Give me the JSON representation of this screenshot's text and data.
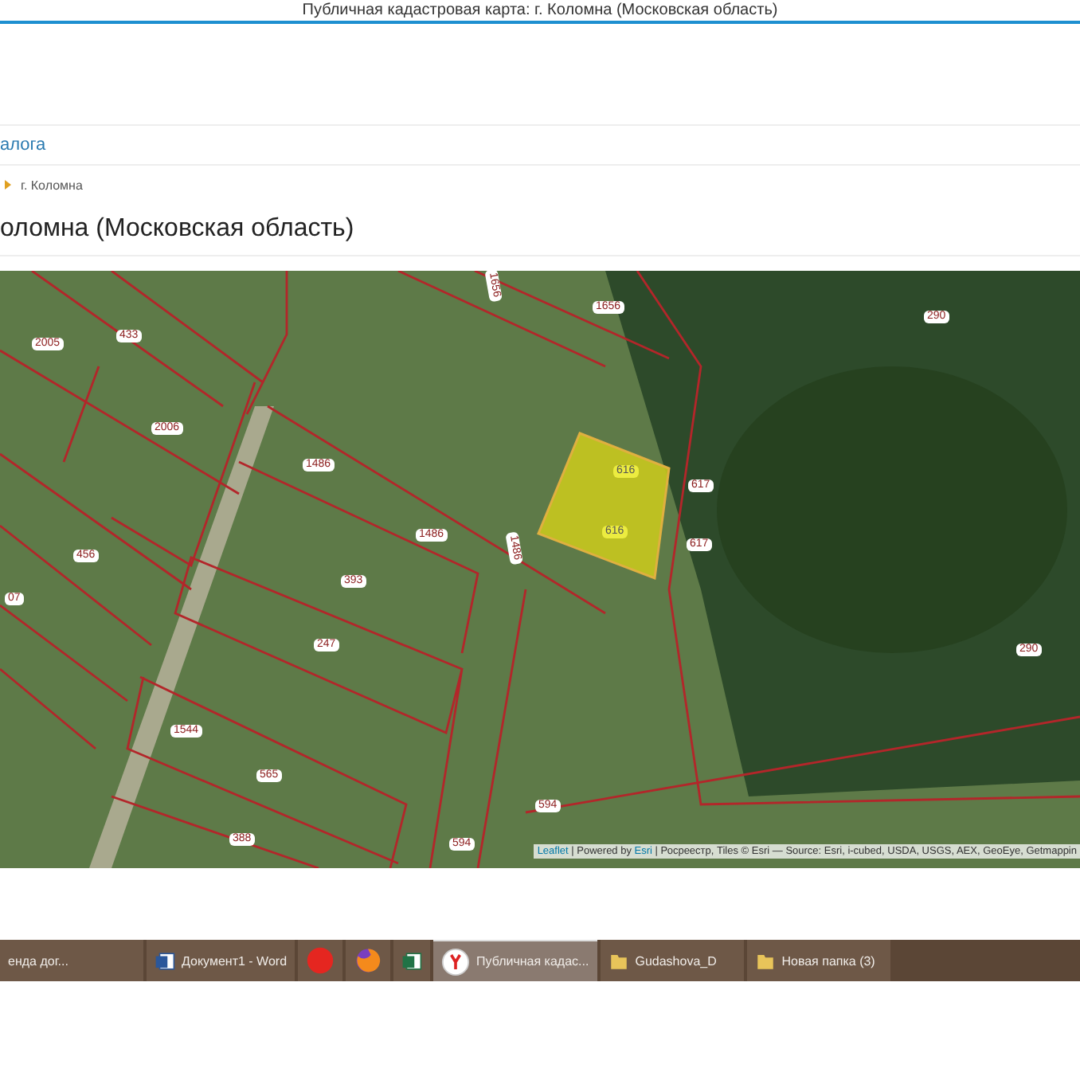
{
  "browser_title": "Публичная кадастровая карта: г. Коломна (Московская область)",
  "nav_link": "алога",
  "breadcrumb": "г. Коломна",
  "page_title": "оломна (Московская область)",
  "map": {
    "parcel_labels": [
      {
        "text": "2005",
        "selected": false
      },
      {
        "text": "433",
        "selected": false
      },
      {
        "text": "1656",
        "selected": false
      },
      {
        "text": "1656",
        "selected": false
      },
      {
        "text": "290",
        "selected": false
      },
      {
        "text": "2006",
        "selected": false
      },
      {
        "text": "1486",
        "selected": false
      },
      {
        "text": "1486",
        "selected": false
      },
      {
        "text": "1486",
        "selected": false
      },
      {
        "text": "616",
        "selected": true
      },
      {
        "text": "616",
        "selected": true
      },
      {
        "text": "617",
        "selected": false
      },
      {
        "text": "617",
        "selected": false
      },
      {
        "text": "456",
        "selected": false
      },
      {
        "text": "07",
        "selected": false
      },
      {
        "text": "393",
        "selected": false
      },
      {
        "text": "247",
        "selected": false
      },
      {
        "text": "290",
        "selected": false
      },
      {
        "text": "1544",
        "selected": false
      },
      {
        "text": "565",
        "selected": false
      },
      {
        "text": "388",
        "selected": false
      },
      {
        "text": "594",
        "selected": false
      },
      {
        "text": "594",
        "selected": false
      }
    ],
    "attribution": [
      {
        "kind": "link",
        "text": "Leaflet"
      },
      {
        "kind": "text",
        "text": " | Powered by "
      },
      {
        "kind": "link",
        "text": "Esri"
      },
      {
        "kind": "text",
        "text": " | Росреестр, Tiles © Esri — Source: Esri, i-cubed, USDA, USGS, AEX, GeoEye, Getmappin"
      }
    ]
  },
  "taskbar": [
    {
      "kind": "generic",
      "label": "енда дог...",
      "selected": false
    },
    {
      "kind": "word",
      "label": "Документ1 - Word",
      "selected": false
    },
    {
      "kind": "yandex",
      "selected": false
    },
    {
      "kind": "firefox",
      "selected": false
    },
    {
      "kind": "excel",
      "selected": false
    },
    {
      "kind": "browser",
      "label": "Публичная кадас...",
      "selected": true
    },
    {
      "kind": "folder",
      "label": "Gudashova_D",
      "selected": false
    },
    {
      "kind": "folder",
      "label": "Новая папка (3)",
      "selected": false
    }
  ]
}
